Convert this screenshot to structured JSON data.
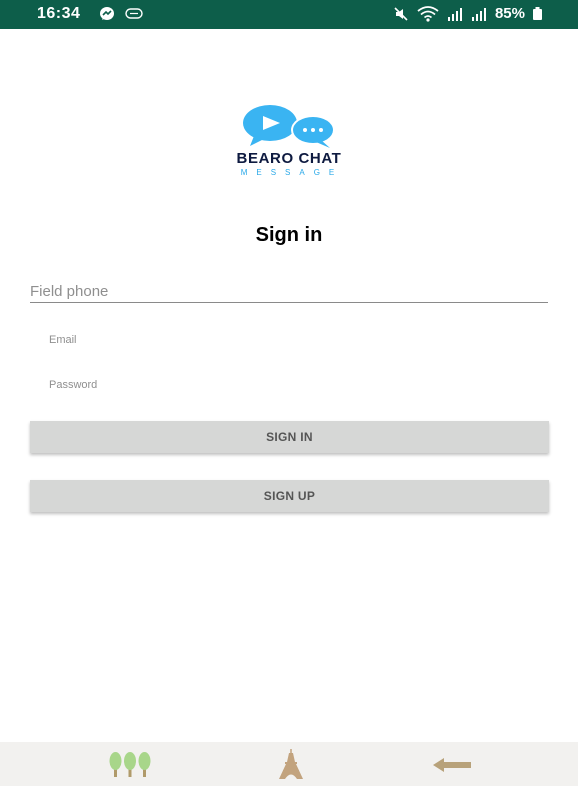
{
  "status_bar": {
    "time": "16:34",
    "battery": "85%",
    "icons": [
      "messenger-icon",
      "chat-bubble-icon",
      "mute-icon",
      "wifi-icon",
      "signal-icon",
      "signal-icon",
      "battery-icon"
    ]
  },
  "logo": {
    "name": "BEARO CHAT",
    "tagline": "MESSAGE",
    "colors": {
      "bubble": "#3ab4f2",
      "name": "#0e1a40",
      "tagline": "#28a8e8"
    }
  },
  "title": "Sign in",
  "form": {
    "phone_placeholder": "Field phone",
    "email_placeholder": "Email",
    "password_placeholder": "Password"
  },
  "buttons": {
    "sign_in": "SIGN IN",
    "sign_up": "SIGN UP"
  },
  "bottom_nav": {
    "items": [
      "trees-icon",
      "eiffel-tower-icon",
      "back-arrow-icon"
    ]
  },
  "colors": {
    "status_bar": "#0d5e4a",
    "button_bg": "#d6d7d6",
    "nav_bg": "#f2f1ef"
  }
}
